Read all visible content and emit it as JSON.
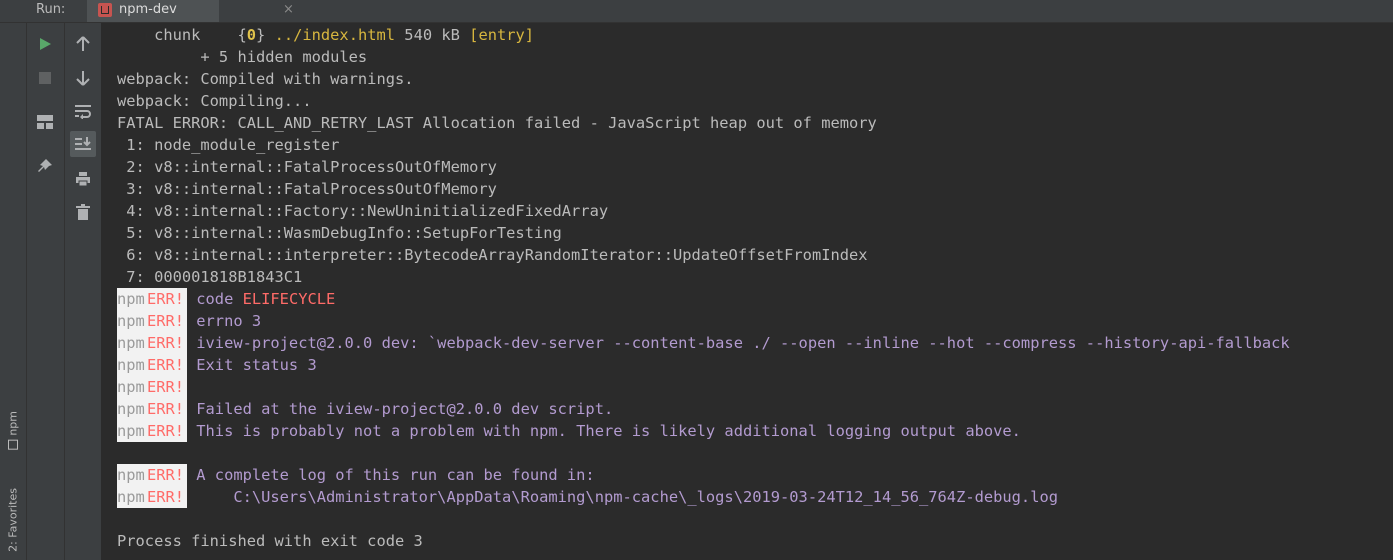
{
  "tabbar": {
    "run_label": "Run:",
    "tab_title": "npm-dev",
    "tab_close": "×"
  },
  "left_strip": {
    "npm_label": "npm",
    "favorites_label": "2: Favorites"
  },
  "toolbar": {
    "run_icon": "play-icon",
    "stop_icon": "stop-icon",
    "layout_icon": "layout-icon",
    "pin_icon": "pin-icon",
    "up_icon": "arrow-up-icon",
    "down_icon": "arrow-down-icon",
    "wrap_icon": "soft-wrap-icon",
    "scroll_end_icon": "scroll-to-end-icon",
    "print_icon": "print-icon",
    "trash_icon": "trash-icon"
  },
  "colors": {
    "background": "#2b2b2b",
    "text": "#bbbbbb",
    "error_red": "#ff6b68",
    "warning_purple": "#b39bd0",
    "yellow": "#d7b63f",
    "run_green": "#59a869"
  },
  "console": {
    "chunk": {
      "prefix": "    chunk    {",
      "id": "0",
      "mid": "} ",
      "file": "../index.html",
      "size": " 540 kB ",
      "tag": "[entry]"
    },
    "hidden_modules": "         + 5 hidden modules",
    "compiled_warnings": "webpack: Compiled with warnings.",
    "compiling": "webpack: Compiling...",
    "fatal": "FATAL ERROR: CALL_AND_RETRY_LAST Allocation failed - JavaScript heap out of memory",
    "stack": [
      " 1: node_module_register",
      " 2: v8::internal::FatalProcessOutOfMemory",
      " 3: v8::internal::FatalProcessOutOfMemory",
      " 4: v8::internal::Factory::NewUninitializedFixedArray",
      " 5: v8::internal::WasmDebugInfo::SetupForTesting",
      " 6: v8::internal::interpreter::BytecodeArrayRandomIterator::UpdateOffsetFromIndex",
      " 7: 000001818B1843C1"
    ],
    "npm_label": "npm",
    "err_label": "ERR!",
    "err_code_label": " code ",
    "err_code_value": "ELIFECYCLE",
    "err_lines": [
      " errno 3",
      " iview-project@2.0.0 dev: `webpack-dev-server --content-base ./ --open --inline --hot --compress --history-api-fallback",
      " Exit status 3",
      "",
      " Failed at the iview-project@2.0.0 dev script.",
      " This is probably not a problem with npm. There is likely additional logging output above."
    ],
    "log_lines": [
      " A complete log of this run can be found in:",
      "     C:\\Users\\Administrator\\AppData\\Roaming\\npm-cache\\_logs\\2019-03-24T12_14_56_764Z-debug.log"
    ],
    "finished": "Process finished with exit code 3"
  }
}
